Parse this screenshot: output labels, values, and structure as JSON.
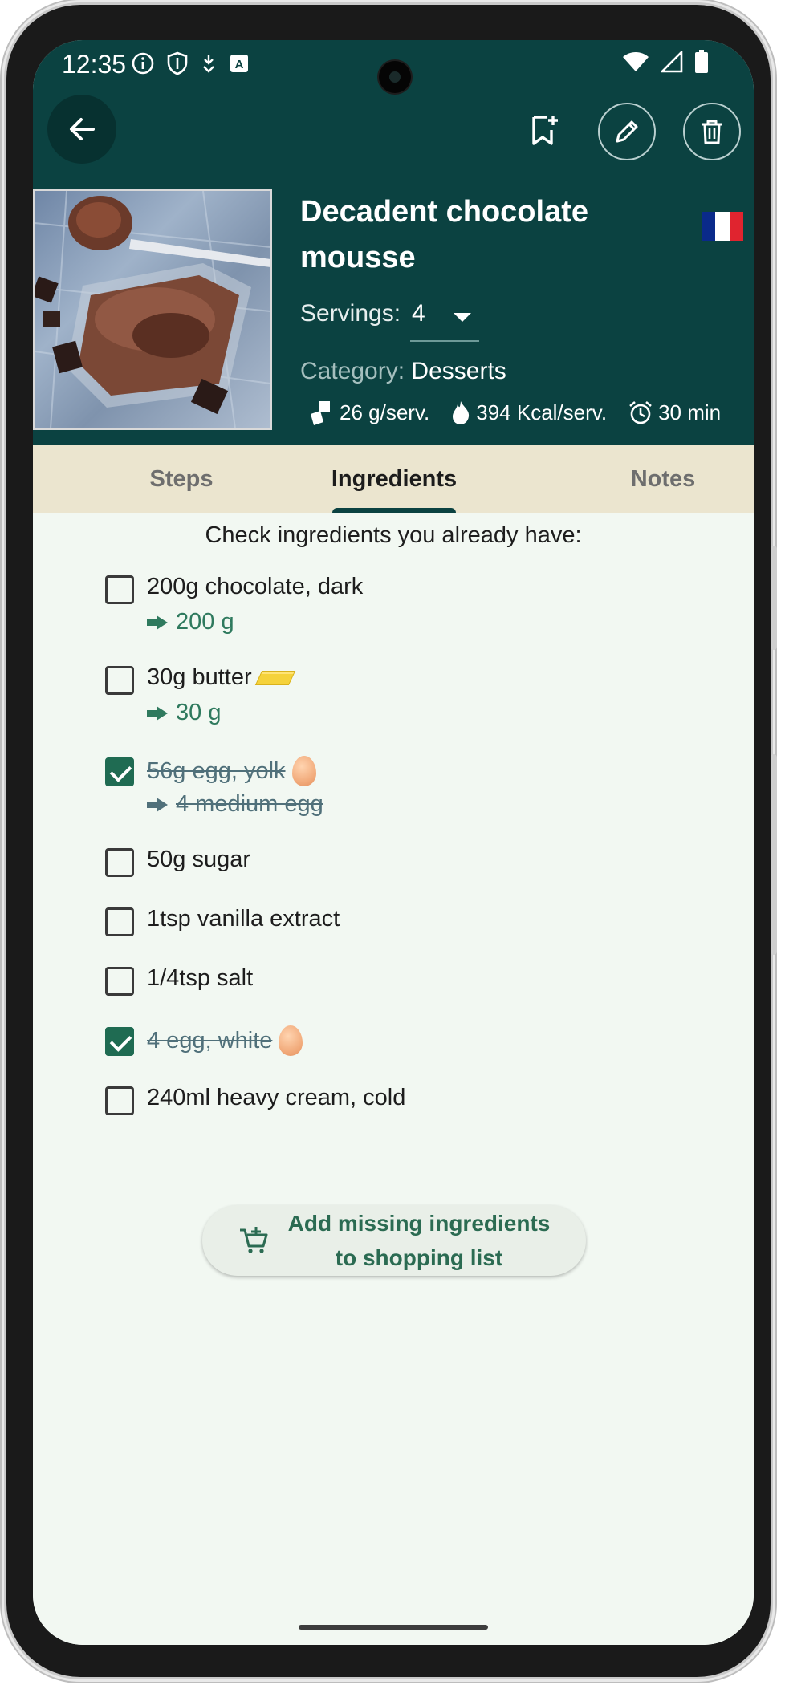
{
  "status_bar": {
    "time": "12:35",
    "left_icons": [
      "info-icon",
      "shield-icon",
      "download-icon",
      "a-icon"
    ],
    "right_icons": [
      "wifi-icon",
      "signal-icon",
      "battery-icon"
    ]
  },
  "header": {
    "background": "#0b4241",
    "actions": [
      "back-arrow-icon",
      "bookmark-add-icon",
      "pencil-icon",
      "trash-icon"
    ],
    "recipe_title": "Decadent chocolate mousse",
    "flag_colors": [
      "#0a2a8a",
      "#ffffff",
      "#e0242f"
    ],
    "servings_label": "Servings:",
    "servings_value": "4",
    "category_label": "Category:",
    "category_value": "Desserts",
    "stats": {
      "weight": "26 g/serv.",
      "calories": "394 Kcal/serv.",
      "time": "30 min"
    }
  },
  "tabs": [
    {
      "label": "Steps",
      "active": false
    },
    {
      "label": "Ingredients",
      "active": true
    },
    {
      "label": "Notes",
      "active": false
    }
  ],
  "ingredients": {
    "intro": "Check ingredients you already have:",
    "items": [
      {
        "name": "200g chocolate, dark",
        "converted": "200 g",
        "checked": false
      },
      {
        "name": "30g butter",
        "converted": "30 g",
        "checked": false
      },
      {
        "name": "56g egg, yolk",
        "converted": "4 medium egg",
        "checked": true
      },
      {
        "name": "50g sugar",
        "checked": false
      },
      {
        "name": "1tsp vanilla extract",
        "checked": false
      },
      {
        "name": "1/4tsp salt",
        "checked": false
      },
      {
        "name": "4 egg, white",
        "checked": true
      },
      {
        "name": "240ml heavy cream, cold",
        "checked": false
      }
    ],
    "shopping_button": "Add missing ingredients to shopping list",
    "shopping_button_line1": "Add missing ingredients",
    "shopping_button_line2": "to shopping list"
  },
  "colors": {
    "accent_green": "#2f7a5e",
    "tab_bar": "#ebe5cf",
    "content_bg": "#f2f8f2"
  }
}
